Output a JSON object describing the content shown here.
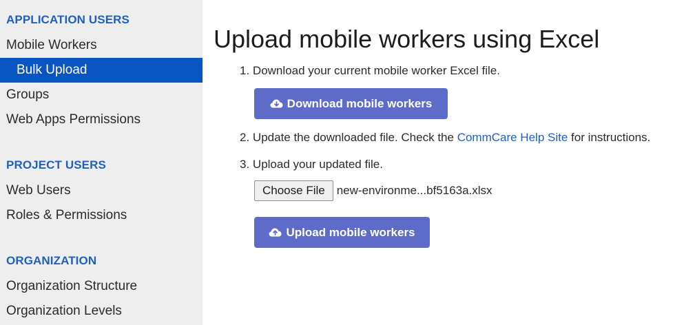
{
  "sidebar": {
    "sections": [
      {
        "title": "APPLICATION USERS",
        "items": [
          {
            "label": "Mobile Workers"
          },
          {
            "label": "Bulk Upload"
          },
          {
            "label": "Groups"
          },
          {
            "label": "Web Apps Permissions"
          }
        ]
      },
      {
        "title": "PROJECT USERS",
        "items": [
          {
            "label": "Web Users"
          },
          {
            "label": "Roles & Permissions"
          }
        ]
      },
      {
        "title": "ORGANIZATION",
        "items": [
          {
            "label": "Organization Structure"
          },
          {
            "label": "Organization Levels"
          }
        ]
      }
    ],
    "active_item": "Bulk Upload"
  },
  "main": {
    "title": "Upload mobile workers using Excel",
    "steps": [
      {
        "number": "1.",
        "text": "Download your current mobile worker Excel file."
      },
      {
        "number": "2.",
        "text_before": "Update the downloaded file. Check the ",
        "link": "CommCare Help Site",
        "text_after": " for instructions."
      },
      {
        "number": "3.",
        "text": "Upload your updated file."
      }
    ],
    "download_button": {
      "label": "Download mobile workers",
      "icon": "cloud-download-icon"
    },
    "file_input": {
      "button_label": "Choose File",
      "file_name": "new-environme...bf5163a.xlsx"
    },
    "upload_button": {
      "label": "Upload mobile workers",
      "icon": "cloud-upload-icon"
    }
  },
  "colors": {
    "sidebar_bg": "#eeeeee",
    "section_title": "#1f5fbf",
    "active_item_bg": "#0a55c4",
    "primary_button": "#5d6cc8",
    "link": "#1f5fbf"
  }
}
